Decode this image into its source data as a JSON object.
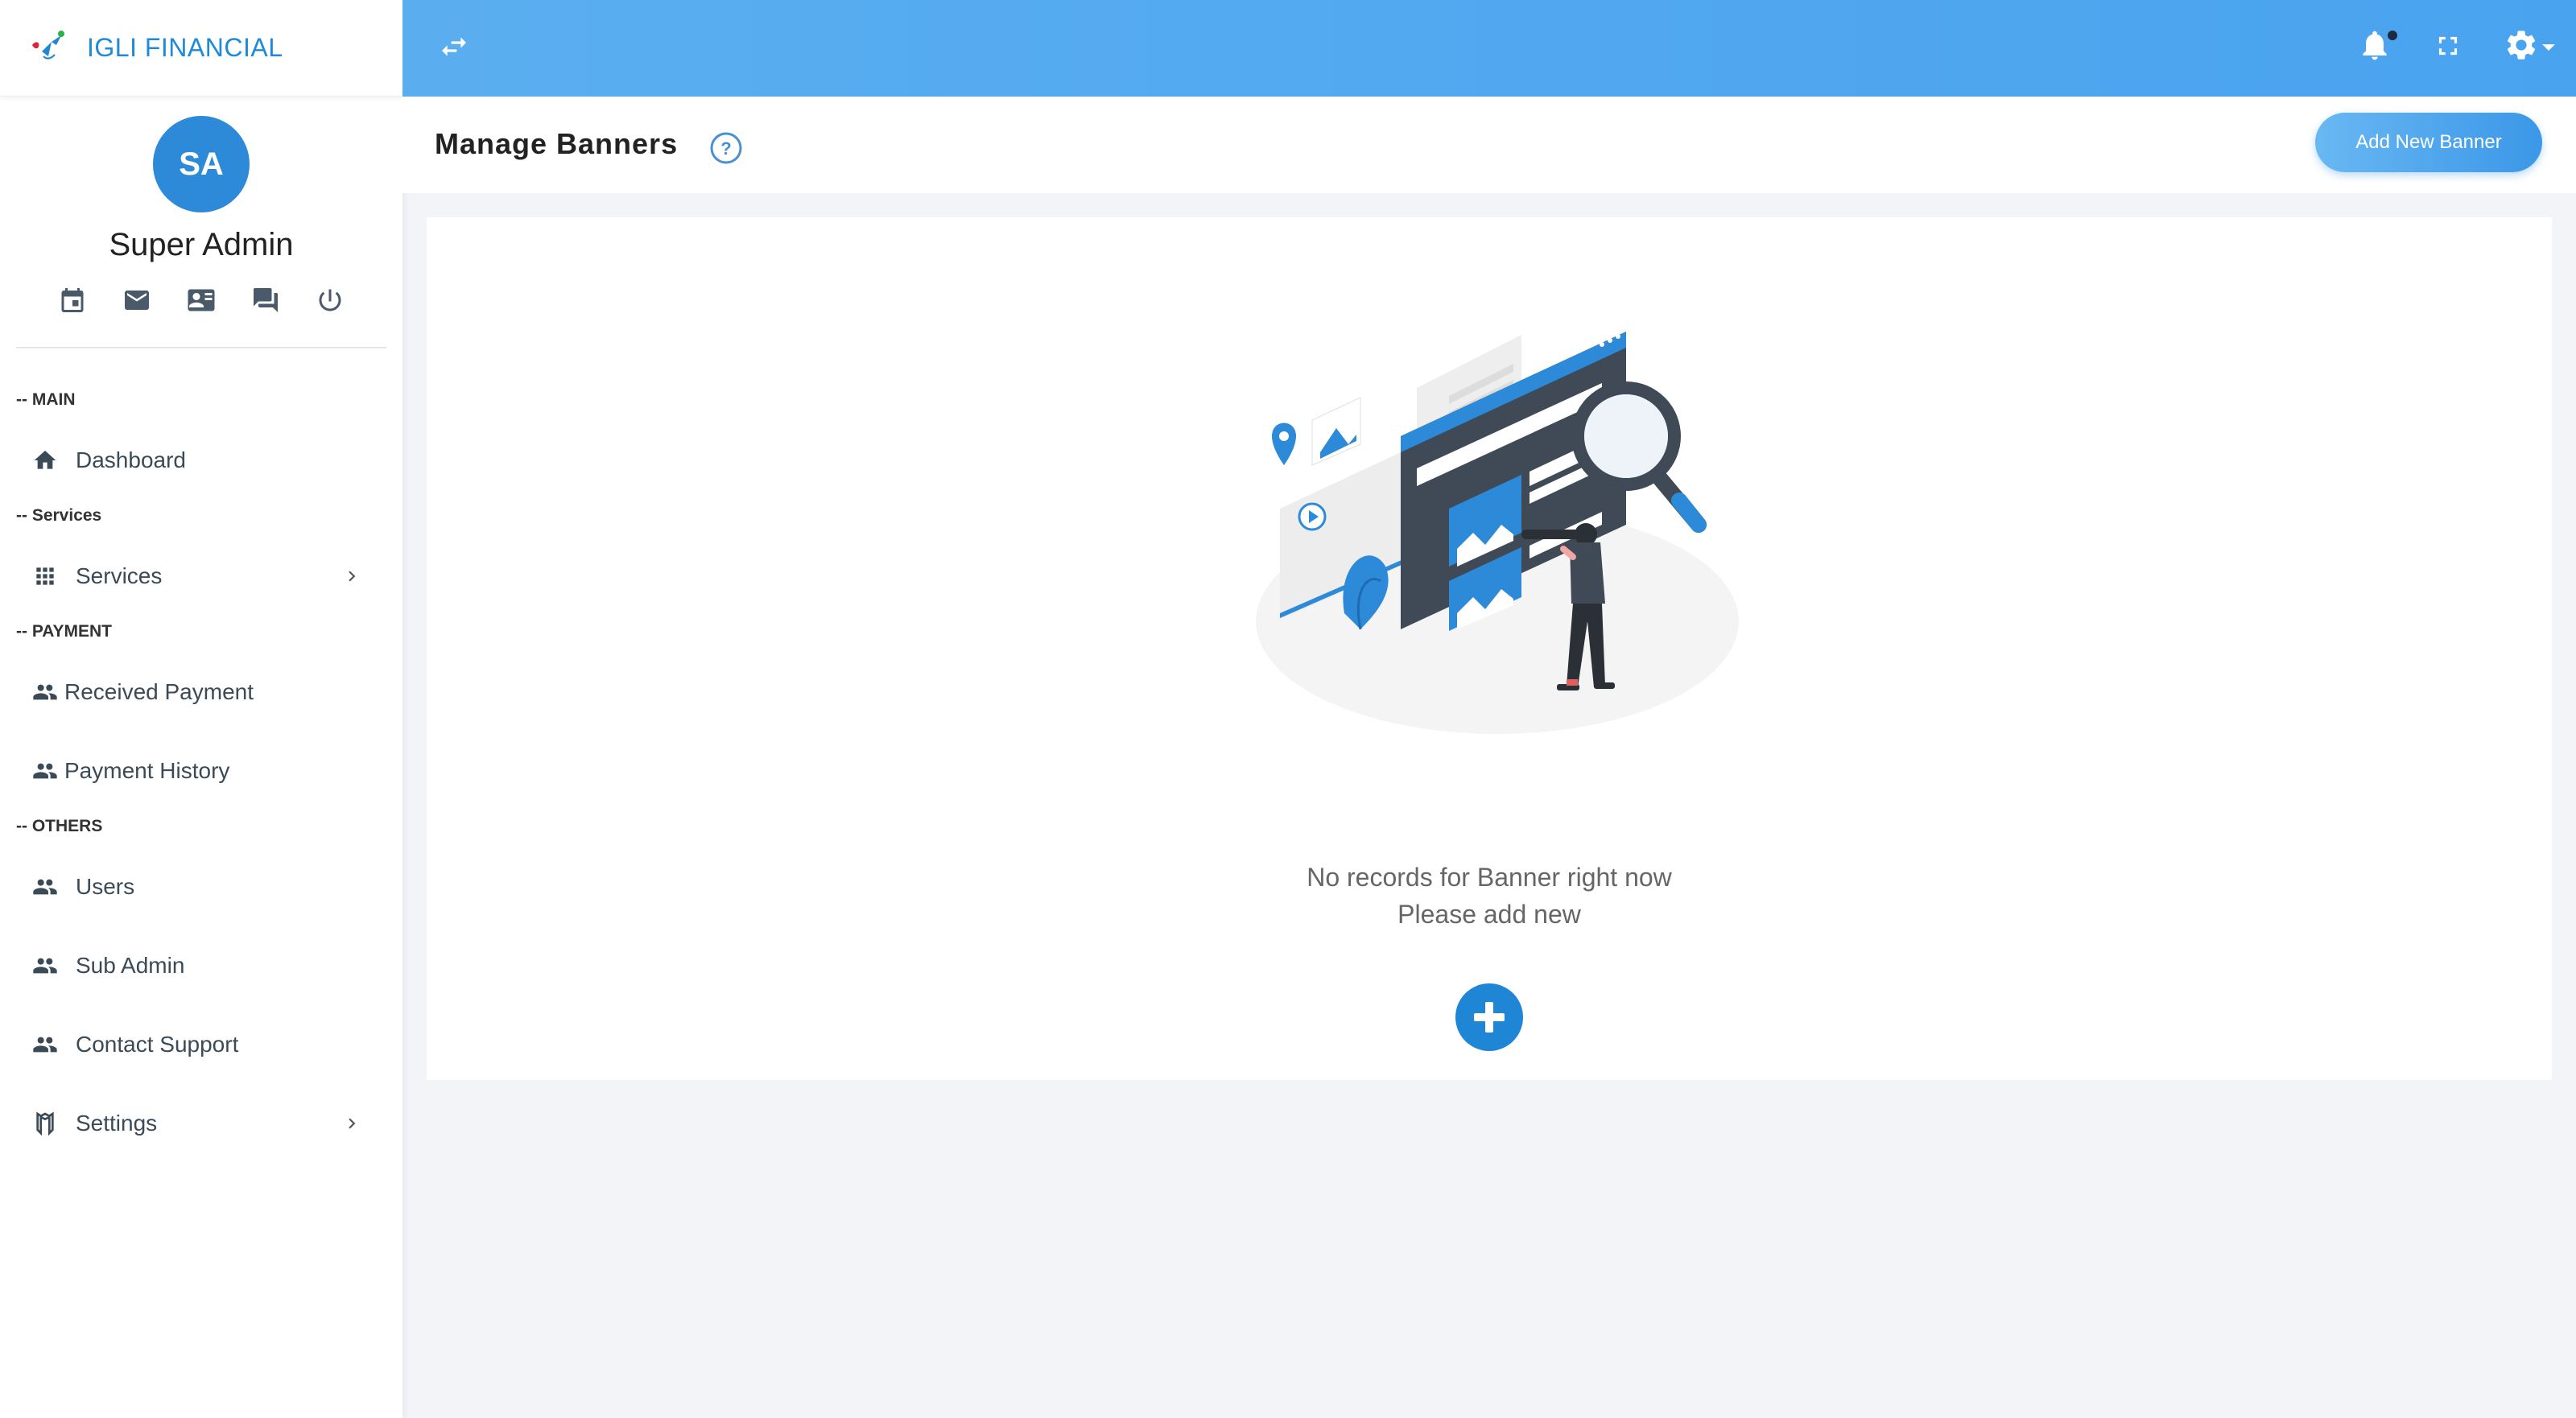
{
  "brand": {
    "name": "IGLI FINANCIAL"
  },
  "profile": {
    "initials": "SA",
    "name": "Super Admin"
  },
  "profile_icons": [
    "calendar-icon",
    "mail-icon",
    "contact-card-icon",
    "chat-icon",
    "power-icon"
  ],
  "sidebar": {
    "sections": [
      {
        "label": "-- MAIN"
      },
      {
        "label": "-- Services"
      },
      {
        "label": "-- PAYMENT"
      },
      {
        "label": "-- OTHERS"
      }
    ],
    "items": {
      "dashboard": "Dashboard",
      "services": "Services",
      "received_payment": "Received Payment",
      "payment_history": "Payment History",
      "users": "Users",
      "sub_admin": "Sub Admin",
      "contact_support": "Contact Support",
      "settings": "Settings"
    }
  },
  "header": {
    "title": "Manage Banners",
    "add_button": "Add New Banner"
  },
  "empty_state": {
    "line1": "No records for Banner right now",
    "line2": "Please add new"
  },
  "colors": {
    "accent": "#1f86d6",
    "topbar": "#4aa3ef",
    "brand_text": "#1f8ad8"
  }
}
